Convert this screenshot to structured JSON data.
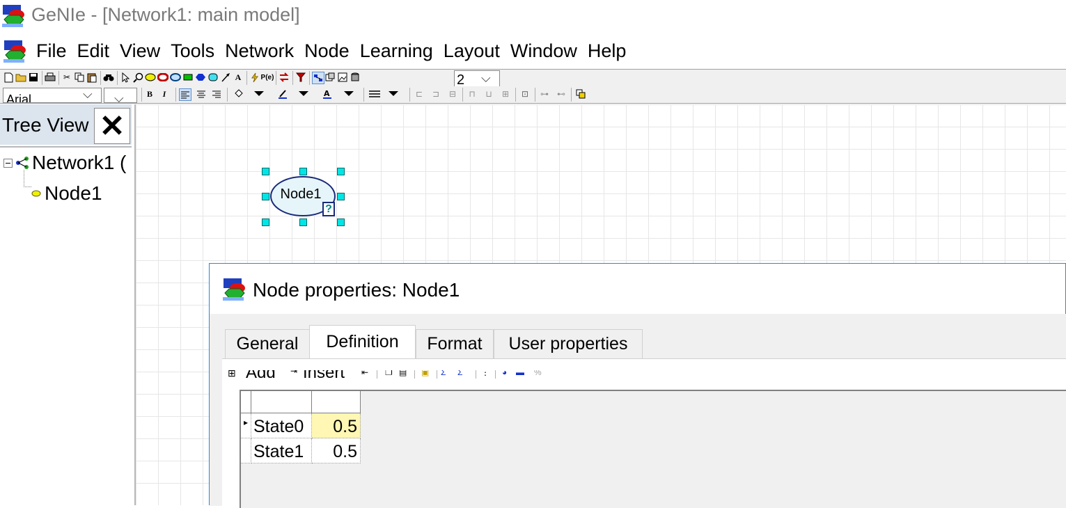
{
  "window": {
    "title": "GeNIe - [Network1: main model]"
  },
  "menu": {
    "items": [
      "File",
      "Edit",
      "View",
      "Tools",
      "Network",
      "Node",
      "Learning",
      "Layout",
      "Window",
      "Help"
    ]
  },
  "format_toolbar": {
    "font_name": "Arial",
    "zoom_value": "2"
  },
  "tree_view": {
    "title": "Tree View",
    "close_glyph": "✕",
    "root_label": "Network1 (",
    "child_label": "Node1"
  },
  "canvas": {
    "node_label": "Node1",
    "node_badge": "?"
  },
  "dialog": {
    "title": "Node properties: Node1",
    "tabs": [
      "General",
      "Definition",
      "Format",
      "User properties"
    ],
    "active_tab": "Definition",
    "toolbar_labels": {
      "add": "Add",
      "insert": "Insert"
    },
    "table": {
      "rows": [
        {
          "state": "State0",
          "value": "0.5"
        },
        {
          "state": "State1",
          "value": "0.5"
        }
      ]
    }
  },
  "colors": {
    "handle": "#00e5e5",
    "node_fill": "#e6f5fa",
    "node_stroke": "#1a2a7a",
    "selected_cell": "#fff7b3",
    "tree_header": "#dce4ee",
    "dialog_border": "#2b87d8"
  }
}
